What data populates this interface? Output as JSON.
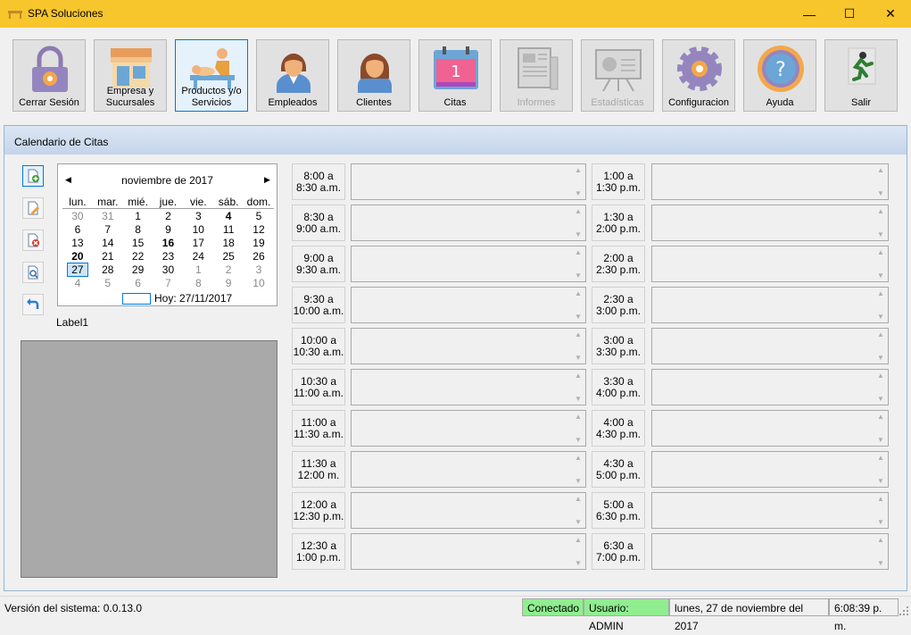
{
  "window": {
    "title": "SPA Soluciones",
    "minimize": "—",
    "maximize": "☐",
    "close": "✕"
  },
  "toolbar": [
    {
      "label": "Cerrar Sesión",
      "icon": "lock-icon",
      "enabled": true
    },
    {
      "label": "Empresa y Sucursales",
      "icon": "store-icon",
      "enabled": true
    },
    {
      "label": "Productos y/o Servicios",
      "icon": "massage-icon",
      "enabled": true,
      "selected": true
    },
    {
      "label": "Empleados",
      "icon": "employee-icon",
      "enabled": true
    },
    {
      "label": "Clientes",
      "icon": "client-icon",
      "enabled": true
    },
    {
      "label": "Citas",
      "icon": "calendar-icon",
      "enabled": true
    },
    {
      "label": "Informes",
      "icon": "report-icon",
      "enabled": false
    },
    {
      "label": "Estadísticas",
      "icon": "statistics-icon",
      "enabled": false
    },
    {
      "label": "Configuracion",
      "icon": "gear-icon",
      "enabled": true
    },
    {
      "label": "Ayuda",
      "icon": "help-icon",
      "enabled": true
    },
    {
      "label": "Salir",
      "icon": "exit-icon",
      "enabled": true
    }
  ],
  "panel": {
    "title": "Calendario de Citas"
  },
  "sidebar_buttons": [
    {
      "name": "new-appointment-button",
      "icon": "file-add-icon"
    },
    {
      "name": "edit-appointment-button",
      "icon": "file-edit-icon"
    },
    {
      "name": "delete-appointment-button",
      "icon": "file-delete-icon"
    },
    {
      "name": "search-appointment-button",
      "icon": "file-search-icon"
    },
    {
      "name": "undo-button",
      "icon": "undo-arrow-icon"
    }
  ],
  "calendar": {
    "month_label": "noviembre de 2017",
    "prev": "◀",
    "next": "▶",
    "weekdays": [
      "lun.",
      "mar.",
      "mié.",
      "jue.",
      "vie.",
      "sáb.",
      "dom."
    ],
    "weeks": [
      [
        {
          "d": "30",
          "o": true
        },
        {
          "d": "31",
          "o": true
        },
        {
          "d": "1"
        },
        {
          "d": "2"
        },
        {
          "d": "3"
        },
        {
          "d": "4",
          "b": true
        },
        {
          "d": "5"
        }
      ],
      [
        {
          "d": "6"
        },
        {
          "d": "7"
        },
        {
          "d": "8"
        },
        {
          "d": "9"
        },
        {
          "d": "10"
        },
        {
          "d": "11"
        },
        {
          "d": "12"
        }
      ],
      [
        {
          "d": "13"
        },
        {
          "d": "14"
        },
        {
          "d": "15"
        },
        {
          "d": "16",
          "b": true
        },
        {
          "d": "17"
        },
        {
          "d": "18"
        },
        {
          "d": "19"
        }
      ],
      [
        {
          "d": "20",
          "b": true
        },
        {
          "d": "21"
        },
        {
          "d": "22"
        },
        {
          "d": "23"
        },
        {
          "d": "24"
        },
        {
          "d": "25"
        },
        {
          "d": "26"
        }
      ],
      [
        {
          "d": "27",
          "t": true
        },
        {
          "d": "28"
        },
        {
          "d": "29"
        },
        {
          "d": "30"
        },
        {
          "d": "1",
          "o": true
        },
        {
          "d": "2",
          "o": true
        },
        {
          "d": "3",
          "o": true
        }
      ],
      [
        {
          "d": "4",
          "o": true
        },
        {
          "d": "5",
          "o": true
        },
        {
          "d": "6",
          "o": true
        },
        {
          "d": "7",
          "o": true
        },
        {
          "d": "8",
          "o": true
        },
        {
          "d": "9",
          "o": true
        },
        {
          "d": "10",
          "o": true
        }
      ]
    ],
    "today_label": "Hoy: 27/11/2017"
  },
  "label1": "Label1",
  "slots_left": [
    [
      "8:00 a",
      "8:30 a.m."
    ],
    [
      "8:30 a",
      "9:00 a.m."
    ],
    [
      "9:00 a",
      "9:30 a.m."
    ],
    [
      "9:30 a",
      "10:00 a.m."
    ],
    [
      "10:00 a",
      "10:30 a.m."
    ],
    [
      "10:30 a",
      "11:00 a.m."
    ],
    [
      "11:00 a",
      "11:30 a.m."
    ],
    [
      "11:30 a",
      "12:00 m."
    ],
    [
      "12:00 a",
      "12:30 p.m."
    ],
    [
      "12:30 a",
      "1:00 p.m."
    ]
  ],
  "slots_right": [
    [
      "1:00 a",
      "1:30 p.m."
    ],
    [
      "1:30 a",
      "2:00 p.m."
    ],
    [
      "2:00 a",
      "2:30 p.m."
    ],
    [
      "2:30 a",
      "3:00 p.m."
    ],
    [
      "3:00 a",
      "3:30 p.m."
    ],
    [
      "3:30 a",
      "4:00 p.m."
    ],
    [
      "4:00 a",
      "4:30 p.m."
    ],
    [
      "4:30 a",
      "5:00 p.m."
    ],
    [
      "5:00 a",
      "6:30 p.m."
    ],
    [
      "6:30 a",
      "7:00 p.m."
    ]
  ],
  "status": {
    "version": "Versión del sistema: 0.0.13.0",
    "connection": "Conectado",
    "user": "Usuario: ADMIN",
    "date": "lunes, 27 de noviembre del 2017",
    "time": "6:08:39 p. m."
  },
  "colors": {
    "titlebar": "#f7c52c",
    "status_green": "#90ee90",
    "accent": "#0078d7"
  }
}
